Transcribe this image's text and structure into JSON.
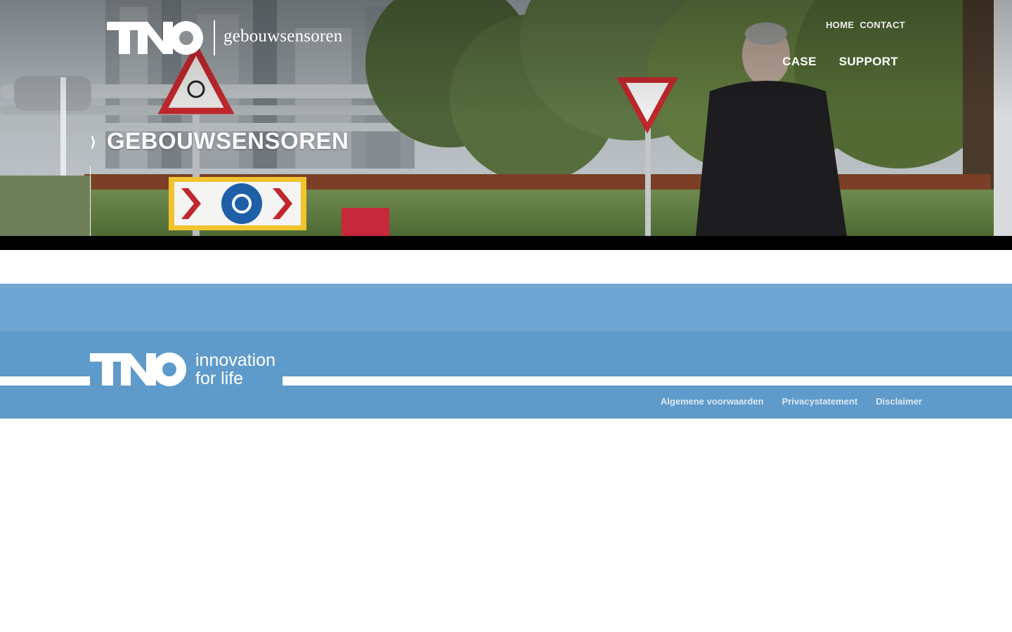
{
  "brand": {
    "logo": "TNO",
    "subtitle": "gebouwsensoren"
  },
  "header": {
    "top_links": [
      "HOME",
      "CONTACT"
    ],
    "main_nav": [
      "CASE",
      "SUPPORT"
    ]
  },
  "hero": {
    "breadcrumb_icon": "chevron-right-icon",
    "chevron_glyph": "⟩",
    "title": "GEBOUWSENSOREN"
  },
  "footer": {
    "logo": "TNO",
    "tagline_line1": "innovation",
    "tagline_line2": "for life",
    "links": [
      "Algemene voorwaarden",
      "Privacystatement",
      "Disclaimer"
    ]
  },
  "colors": {
    "footer_light": "#6fa6d2",
    "footer_main": "#5e9bca",
    "hero_bar": "#000000"
  }
}
